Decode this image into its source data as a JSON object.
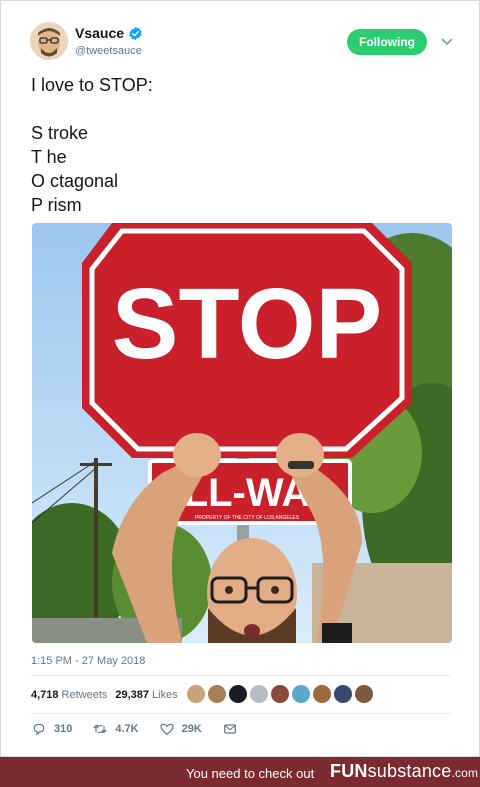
{
  "author": {
    "name": "Vsauce",
    "handle": "@tweetsauce",
    "verified": true
  },
  "follow_button": {
    "label": "Following",
    "color": "#2dcc70"
  },
  "tweet": {
    "lines": [
      "I love to STOP:",
      "",
      "S troke",
      "T he",
      "O ctagonal",
      "P rism"
    ]
  },
  "photo": {
    "sign_text": "STOP",
    "plate_text": "LL-WA",
    "plate_fine_print": "PROPERTY OF THE CITY OF LOS ANGELES"
  },
  "timestamp": "1:15 PM - 27 May 2018",
  "stats": {
    "retweets_count": "4,718",
    "retweets_label": "Retweets",
    "likes_count": "29,387",
    "likes_label": "Likes"
  },
  "liker_colors": [
    "#c9a17a",
    "#a77f56",
    "#1b1d24",
    "#b8bcc2",
    "#8b4b3a",
    "#5aa7c9",
    "#9b6a3d",
    "#3b4a6b",
    "#7c5a3e"
  ],
  "actions": {
    "replies": "310",
    "retweets": "4.7K",
    "likes": "29K"
  },
  "footer": {
    "text": "You need to check out",
    "brand_bold": "FUN",
    "brand_rest": "substance",
    "brand_tld": ".com",
    "color": "#7b2a2f"
  }
}
